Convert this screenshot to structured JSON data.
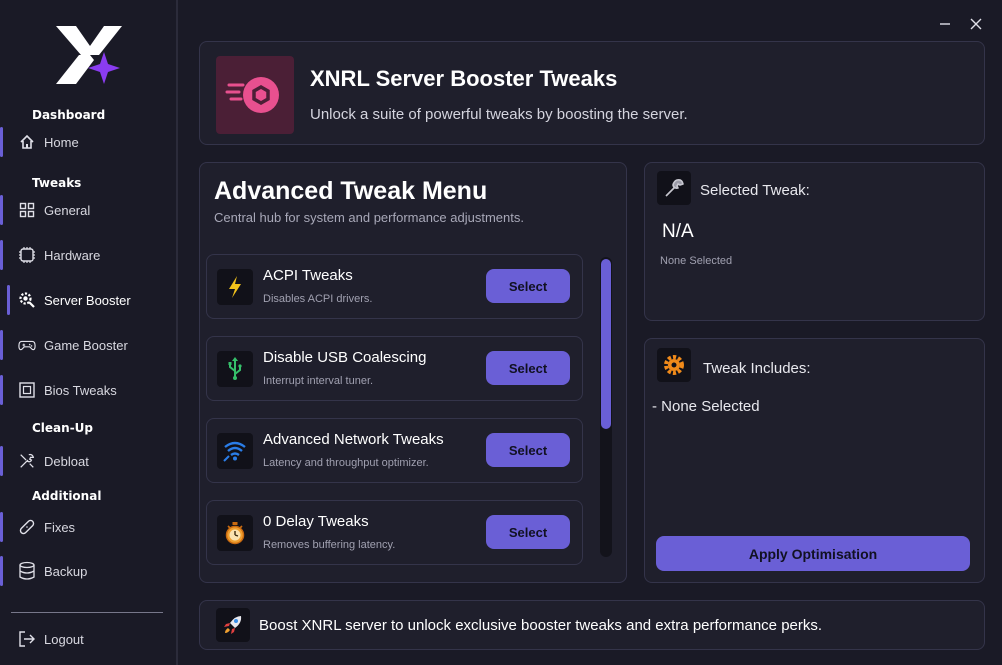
{
  "sidebar": {
    "sections": {
      "dashboard": "Dashboard",
      "tweaks": "Tweaks",
      "cleanup": "Clean-Up",
      "additional": "Additional"
    },
    "items": [
      {
        "label": "Home",
        "icon": "home-icon"
      },
      {
        "label": "General",
        "icon": "grid-icon"
      },
      {
        "label": "Hardware",
        "icon": "chip-icon"
      },
      {
        "label": "Server Booster",
        "icon": "gear-search-icon",
        "active": true
      },
      {
        "label": "Game Booster",
        "icon": "gamepad-icon"
      },
      {
        "label": "Bios Tweaks",
        "icon": "bios-chip-icon"
      },
      {
        "label": "Debloat",
        "icon": "tools-icon"
      },
      {
        "label": "Fixes",
        "icon": "bandage-icon"
      },
      {
        "label": "Backup",
        "icon": "database-icon"
      }
    ],
    "logout": "Logout"
  },
  "header": {
    "title": "XNRL Server Booster Tweaks",
    "subtitle": "Unlock a suite of powerful tweaks by boosting the server."
  },
  "menu": {
    "title": "Advanced Tweak Menu",
    "subtitle": "Central hub for system and performance adjustments.",
    "tweaks": [
      {
        "title": "ACPI Tweaks",
        "desc": "Disables ACPI drivers.",
        "button": "Select",
        "icon": "lightning-icon"
      },
      {
        "title": "Disable USB Coalescing",
        "desc": "Interrupt interval tuner.",
        "button": "Select",
        "icon": "usb-icon"
      },
      {
        "title": "Advanced Network Tweaks",
        "desc": "Latency and throughput optimizer.",
        "button": "Select",
        "icon": "wifi-icon"
      },
      {
        "title": "0 Delay Tweaks",
        "desc": "Removes buffering latency.",
        "button": "Select",
        "icon": "stopwatch-icon"
      }
    ]
  },
  "selected": {
    "title": "Selected Tweak:",
    "value": "N/A",
    "status": "None Selected"
  },
  "includes": {
    "title": "Tweak Includes:",
    "item": "- None Selected",
    "apply": "Apply Optimisation"
  },
  "footer": {
    "text": "Boost XNRL server to unlock exclusive booster tweaks and extra performance perks."
  },
  "colors": {
    "accent": "#6a5fd6",
    "background": "#1a1a26",
    "panel": "#1f1f2c",
    "brand_pink": "#e8508f"
  }
}
